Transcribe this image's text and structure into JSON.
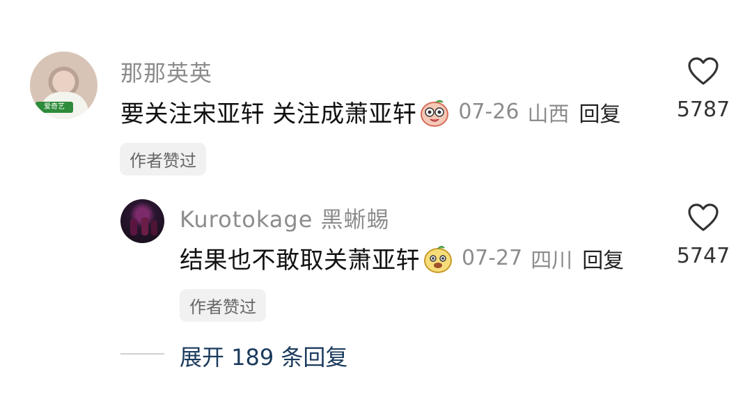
{
  "comments": [
    {
      "username": "那那英英",
      "text": "要关注宋亚轩 关注成萧亚轩",
      "emoji": "blushing-peach-emoji",
      "date": "07-26",
      "location": "山西",
      "reply_label": "回复",
      "likes": "5787",
      "author_liked": "作者赞过",
      "avatar_badge": "爱奇艺"
    },
    {
      "username": "Kurotokage 黑蜥蜴",
      "text": "结果也不敢取关萧亚轩",
      "emoji": "yellow-fruit-emoji",
      "date": "07-27",
      "location": "四川",
      "reply_label": "回复",
      "likes": "5747",
      "author_liked": "作者赞过"
    }
  ],
  "expand": {
    "label": "展开 189 条回复"
  },
  "colors": {
    "username": "#8c8c8c",
    "text": "#111111",
    "expand": "#1a3a5c",
    "chip_bg": "#f1f1f1"
  }
}
